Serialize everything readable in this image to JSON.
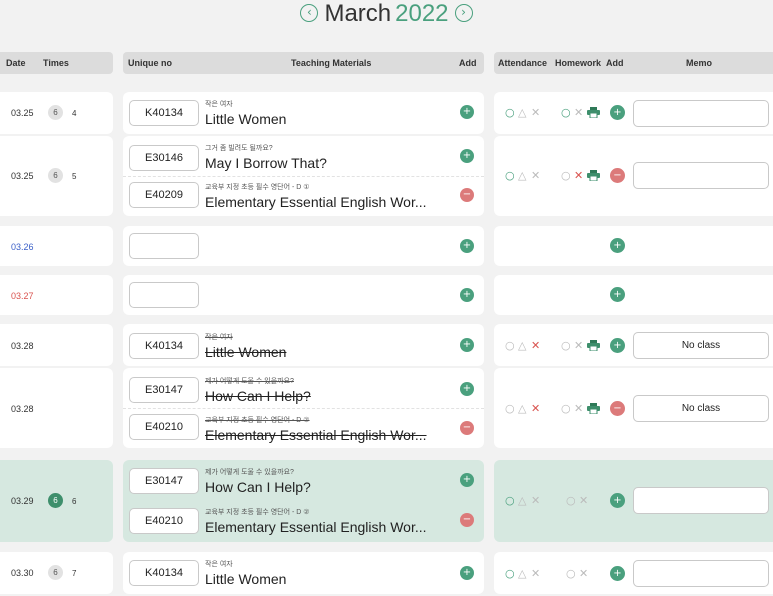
{
  "title": {
    "prev_icon": "‹",
    "month": "March",
    "year": "2022",
    "next_icon": "›"
  },
  "headers": {
    "date": "Date",
    "times": "Times",
    "unique_no": "Unique no",
    "teaching_materials": "Teaching Materials",
    "add": "Add",
    "attendance": "Attendance",
    "homework": "Homework",
    "add2": "Add",
    "memo": "Memo"
  },
  "icons": {
    "plus": "+",
    "minus": "−",
    "o": "○",
    "tri": "△",
    "x": "✕"
  },
  "colors": {
    "accent": "#4aa07e",
    "remove": "#dc7a7a",
    "highlight": "#d6e8e0"
  },
  "rows": [
    {
      "date": "03.25",
      "times_badge": "6",
      "times_num": "4",
      "materials": [
        {
          "code": "K40134",
          "sub": "작은 여자",
          "title": "Little Women"
        }
      ],
      "memo": ""
    },
    {
      "date": "03.25",
      "times_badge": "6",
      "times_num": "5",
      "materials": [
        {
          "code": "E30146",
          "sub": "그거 좀 빌려도 될까요?",
          "title": "May I Borrow That?"
        },
        {
          "code": "E40209",
          "sub": "교육부 지정 초등 필수 영단어 - D ①",
          "title": "Elementary Essential English Wor..."
        }
      ],
      "memo": ""
    },
    {
      "date": "03.26",
      "memo": ""
    },
    {
      "date": "03.27",
      "memo": ""
    },
    {
      "date": "03.28",
      "materials": [
        {
          "code": "K40134",
          "sub": "작은 여자",
          "title": "Little Women"
        }
      ],
      "memo": "No class"
    },
    {
      "date": "03.28",
      "materials": [
        {
          "code": "E30147",
          "sub": "제가 어떻게 도울 수 있을까요?",
          "title": "How Can I Help?"
        },
        {
          "code": "E40210",
          "sub": "교육부 지정 초등 필수 영단어 - D ②",
          "title": "Elementary Essential English Wor..."
        }
      ],
      "memo": "No class"
    },
    {
      "date": "03.29",
      "times_badge": "6",
      "times_num": "6",
      "materials": [
        {
          "code": "E30147",
          "sub": "제가 어떻게 도울 수 있을까요?",
          "title": "How Can I Help?"
        },
        {
          "code": "E40210",
          "sub": "교육부 지정 초등 필수 영단어 - D ②",
          "title": "Elementary Essential English Wor..."
        }
      ],
      "memo": ""
    },
    {
      "date": "03.30",
      "times_badge": "6",
      "times_num": "7",
      "materials": [
        {
          "code": "K40134",
          "sub": "작은 여자",
          "title": "Little Women"
        }
      ],
      "memo": ""
    }
  ]
}
